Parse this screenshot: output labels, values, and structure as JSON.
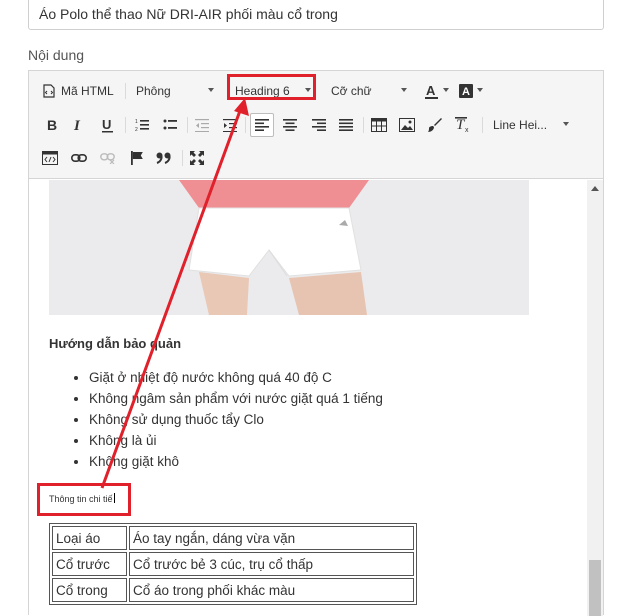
{
  "product_title": "Áo Polo thể thao Nữ DRI-AIR phối màu cổ trong",
  "content_label": "Nội dung",
  "toolbar": {
    "html_label": "Mã HTML",
    "font_label": "Phông",
    "format_label": "Heading 6",
    "size_label": "Cỡ chữ",
    "line_height_label": "Line Hei..."
  },
  "body": {
    "care_heading": "Hướng dẫn bảo quản",
    "care_items": [
      "Giặt ở nhiệt độ nước không quá 40 độ C",
      "Không ngâm sản phẩm với nước giặt quá 1 tiếng",
      "Không sử dụng thuốc tẩy Clo",
      "Không là ủi",
      "Không giặt khô"
    ],
    "detail_heading": "Thông tin chi tiế",
    "table": [
      [
        "Loại áo",
        "Áo tay ngắn, dáng vừa vặn"
      ],
      [
        "Cổ trước",
        "Cổ trước bẻ 3 cúc, trụ cổ thấp"
      ],
      [
        "Cổ trong",
        "Cổ áo trong phối khác màu"
      ]
    ]
  },
  "colors": {
    "annotation_red": "#e0202a",
    "toolbar_bg": "#f5f5f5"
  },
  "icons": [
    "code-icon",
    "bold-icon",
    "italic-icon",
    "underline-icon",
    "ordered-list-icon",
    "unordered-list-icon",
    "outdent-icon",
    "indent-icon",
    "align-left-icon",
    "align-center-icon",
    "align-right-icon",
    "align-justify-icon",
    "table-icon",
    "image-icon",
    "brush-icon",
    "clear-format-icon",
    "embed-icon",
    "link-icon",
    "unlink-icon",
    "flag-icon",
    "quote-icon",
    "fullscreen-icon"
  ]
}
